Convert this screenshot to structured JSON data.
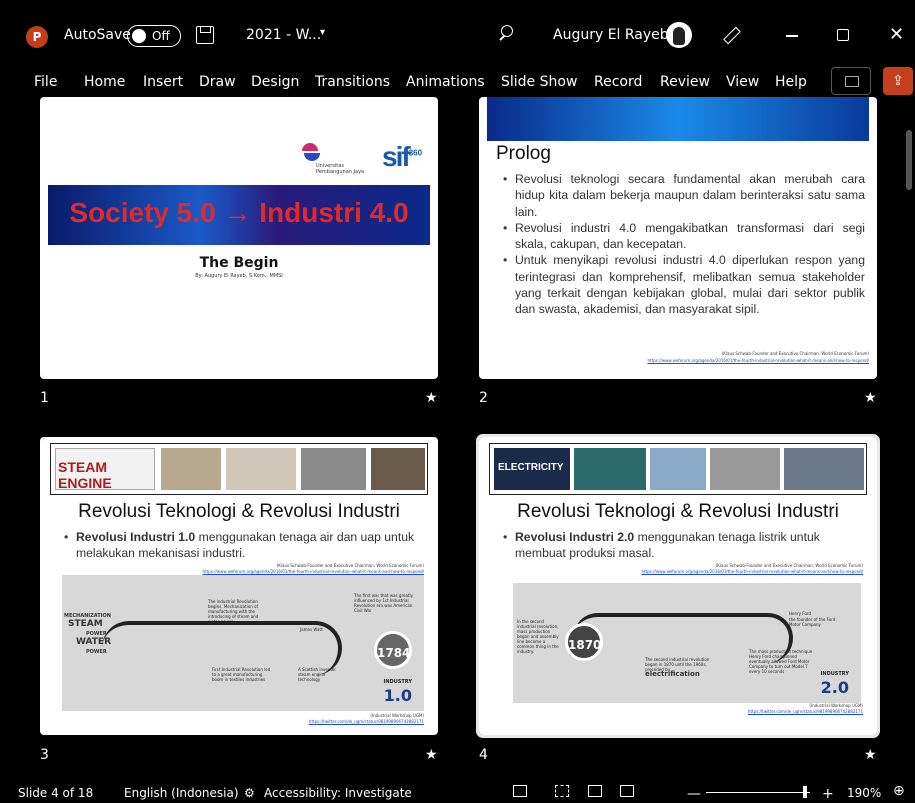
{
  "titlebar": {
    "app_logo": "P",
    "autosave_label": "AutoSave",
    "autosave_state": "Off",
    "doc_title": "2021 - W...",
    "user_name": "Augury El Rayeb"
  },
  "ribbon_tabs": [
    "File",
    "Home",
    "Insert",
    "Draw",
    "Design",
    "Transitions",
    "Animations",
    "Slide Show",
    "Record",
    "Review",
    "View",
    "Help"
  ],
  "slides": [
    {
      "number": "1",
      "banner": "Society 5.0 → Industri 4.0",
      "university": "Universitas\nPembangunan Jaya",
      "logo": "sif",
      "logo_sup": "360",
      "title": "The Begin",
      "subtitle": "By: Augury El Rayeb, S.Kom., MMSI"
    },
    {
      "number": "2",
      "title": "Prolog",
      "bullets": [
        "Revolusi teknologi secara fundamental akan merubah cara hidup kita dalam bekerja maupun dalam berinteraksi satu sama lain.",
        "Revolusi industri 4.0 mengakibatkan transformasi dari segi skala, cakupan, dan kecepatan.",
        "Untuk menyikapi revolusi industri 4.0 diperlukan respon yang terintegrasi dan komprehensif, melibatkan semua stakeholder yang terkait dengan kebijakan global, mulai dari sektor publik dan swasta, akademisi, dan masyarakat sipil."
      ],
      "source": "(Klaus Schwab-Founder and Executive Chairman, World Economic Forum)",
      "source_link": "https://www.weforum.org/agenda/2016/01/the-fourth-industrial-revolution-what-it-means-and-how-to-respond/"
    },
    {
      "number": "3",
      "strip_label": "STEAM ENGINE",
      "title": "Revolusi Teknologi & Revolusi Industri",
      "bullet_bold": "Revolusi Industri 1.0",
      "bullet_rest": " menggunakan tenaga air dan uap untuk melakukan mekanisasi industri.",
      "source": "(Klaus Schwab-Founder and Executive Chairman, World Economic Forum)",
      "source_link": "https://www.weforum.org/agenda/2016/01/the-fourth-industrial-revolution-what-it-means-and-how-to-respond/",
      "info_labels": [
        "MECHANIZATION",
        "STEAM",
        "POWER",
        "WATER",
        "POWER"
      ],
      "info_year": "1784",
      "info_industry": "INDUSTRY",
      "info_version": "1.0",
      "info_text": "The industrial Revolution begins. Mechanization of manufacturing with the introducing of steam and water power.",
      "info_text2": "First Industrial Revolution led to a great manufacturing boom in textiles industries",
      "info_text3": "The first war that was greatly influenced by 1st Industrial Revolution era was American Civil War",
      "info_text4": "A Scottish inventor steam engine technology",
      "info_name": "James Watt",
      "credit": "(Industrial Workshop UGM)",
      "credit_link": "https://twitter.com/de_ugm/status/981998906742882171"
    },
    {
      "number": "4",
      "strip_label": "ELECTRICITY",
      "title": "Revolusi Teknologi & Revolusi Industri",
      "bullet_bold": "Revolusi Industri 2.0",
      "bullet_rest": " menggunakan tenaga listrik untuk membuat produksi masal.",
      "source": "(Klaus Schwab-Founder and Executive Chairman, World Economic Forum)",
      "source_link": "https://www.weforum.org/agenda/2016/01/the-fourth-industrial-revolution-what-it-means-and-how-to-respond/",
      "info_year": "1870",
      "info_industry": "INDUSTRY",
      "info_version": "2.0",
      "info_label": "electrification",
      "info_text": "In the second industrial revolution, mass production began and assembly line become a common thing in the industry.",
      "info_text2": "The second industrial revolution began in 1870 until the 1960s, preceded by",
      "info_text3": "The mass production technique Henry Ford championed eventually allowed Ford Motor Company to turn out Model T every 10 seconds",
      "info_name": "Henry Ford",
      "info_name_sub": "the founder of the Ford Motor Company",
      "credit": "(Industrial Workshop UGM)",
      "credit_link": "https://twitter.com/de_ugm/status/981998906742882171"
    }
  ],
  "status": {
    "slide_info": "Slide 4 of 18",
    "language": "English (Indonesia)",
    "accessibility": "Accessibility: Investigate",
    "zoom": "190%"
  },
  "colors": {
    "share_button": "#c4401d",
    "app_logo": "#c43e1c",
    "banner_text": "#e02a2a",
    "infographic_accent": "#1a3a8a"
  },
  "icons": [
    "powerpoint-logo-icon",
    "save-icon",
    "search-icon",
    "pen-icon",
    "minimize-icon",
    "maximize-icon",
    "close-icon",
    "comment-icon",
    "share-icon",
    "star-icon",
    "accessibility-icon",
    "normal-view-icon",
    "slide-sorter-icon",
    "reading-view-icon",
    "slideshow-icon",
    "fit-slide-icon"
  ]
}
